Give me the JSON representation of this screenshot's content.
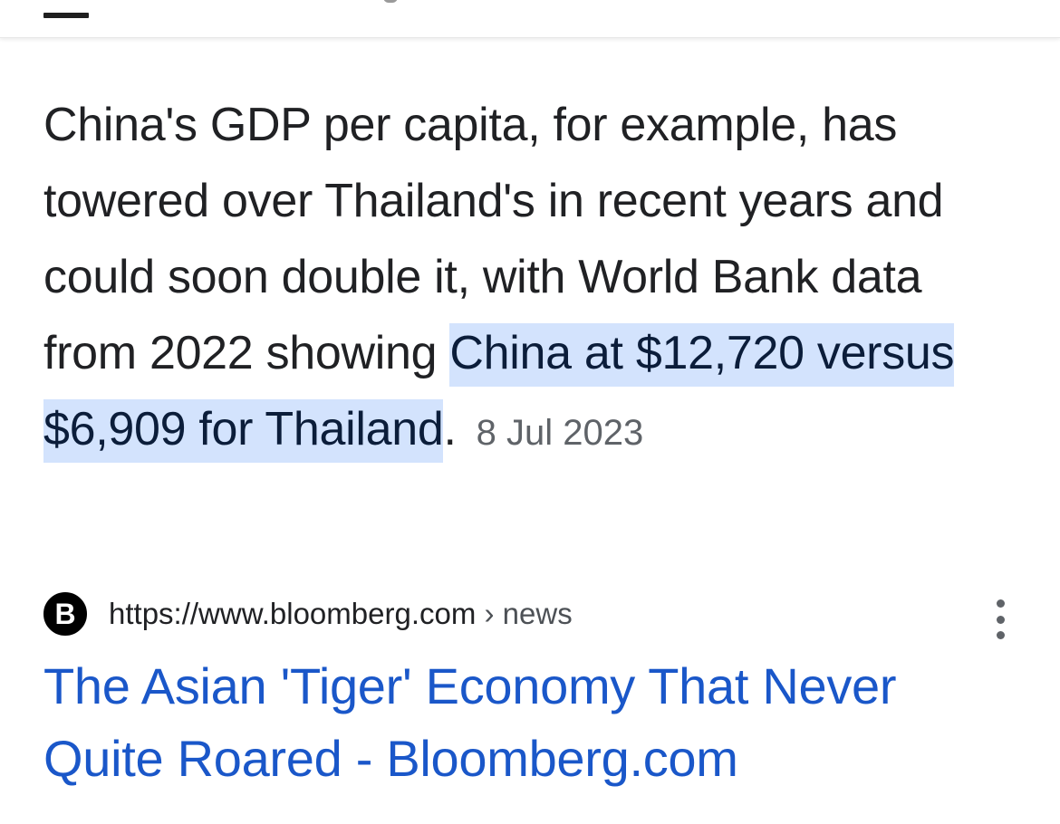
{
  "snippet": {
    "text_before": "China's GDP per capita, for example, has towered over Thailand's in recent years and could soon double it, with World Bank data from 2022 showing ",
    "highlighted": "China at $12,720 versus $6,909 for Thailand",
    "text_after": ".",
    "date": "8 Jul 2023"
  },
  "source": {
    "favicon_letter": "B",
    "url": "https://www.bloomberg.com",
    "breadcrumb": " › news",
    "more_icon": "more-vert-icon"
  },
  "result": {
    "title": "The Asian 'Tiger' Economy That Never Quite Roared - Bloomberg.com",
    "title_color": "#1a57c9"
  },
  "colors": {
    "highlight_bg": "#d3e3fd",
    "text": "#202124",
    "muted": "#5f6368"
  }
}
